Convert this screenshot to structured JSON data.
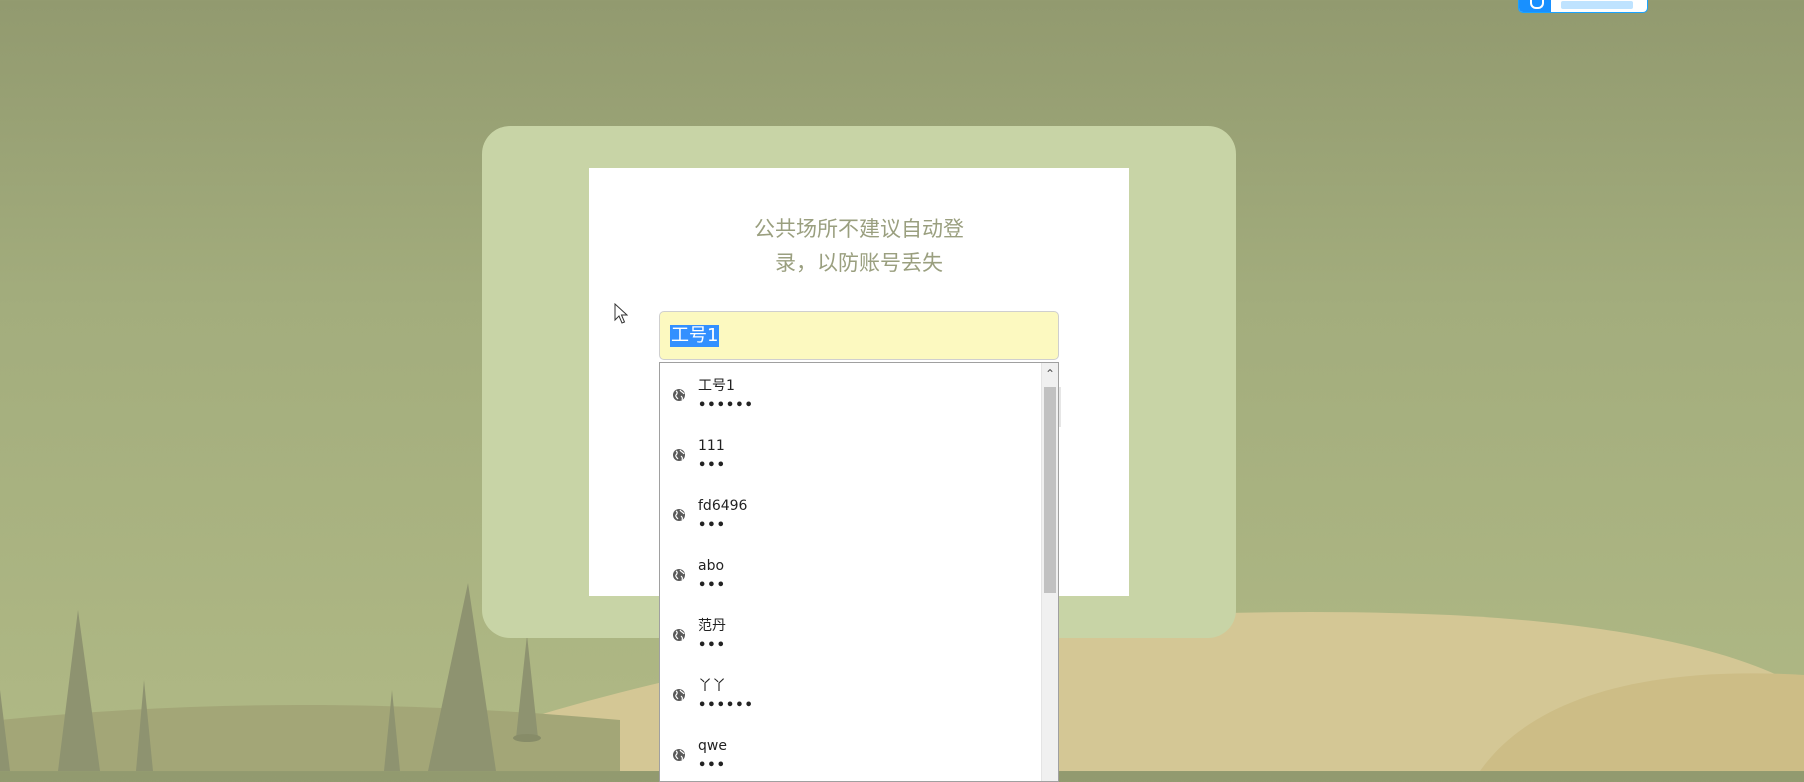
{
  "login": {
    "notice_line1": "公共场所不建议自动登",
    "notice_line2": "录，以防账号丢失",
    "username_value": "工号1"
  },
  "autocomplete": {
    "items": [
      {
        "username": "工号1",
        "password_mask": "••••••"
      },
      {
        "username": "111",
        "password_mask": "•••"
      },
      {
        "username": "fd6496",
        "password_mask": "•••"
      },
      {
        "username": "abo",
        "password_mask": "•••"
      },
      {
        "username": "范丹",
        "password_mask": "•••"
      },
      {
        "username": "丫丫",
        "password_mask": "••••••"
      },
      {
        "username": "qwe",
        "password_mask": "•••"
      }
    ],
    "scroll_up_glyph": "⌃"
  },
  "colors": {
    "background": "#9aa274",
    "panel": "#c8d4a6",
    "input_autofill": "#fcf9c0",
    "selection": "#3390ff",
    "notice_text": "#9a9f7f"
  },
  "icons": [
    "globe-icon",
    "mouse-cursor-icon",
    "scroll-up-arrow-icon"
  ]
}
